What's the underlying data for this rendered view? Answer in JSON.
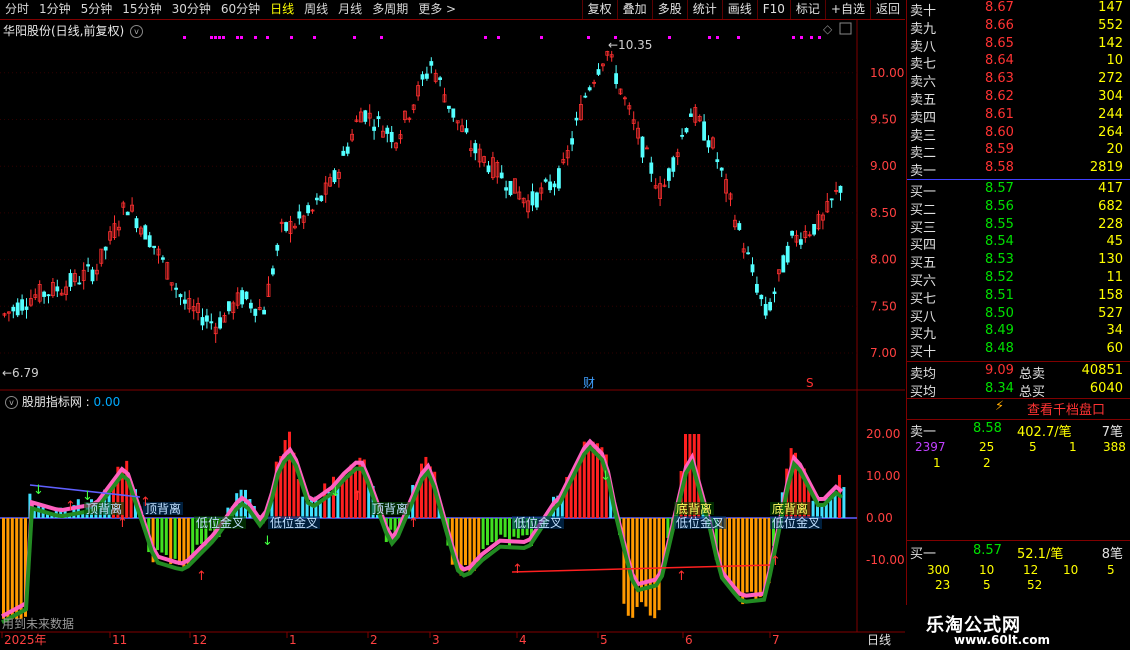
{
  "periods": [
    "分时",
    "1分钟",
    "5分钟",
    "15分钟",
    "30分钟",
    "60分钟",
    "日线",
    "周线",
    "月线",
    "多周期",
    "更多 >"
  ],
  "active_period": "日线",
  "tools": [
    "复权",
    "叠加",
    "多股",
    "统计",
    "画线",
    "F10",
    "标记",
    "+自选",
    "返回"
  ],
  "stock_title": "华阳股份(日线,前复权)",
  "price_axis": [
    "10.00",
    "9.50",
    "9.00",
    "8.50",
    "8.00",
    "7.50",
    "7.00"
  ],
  "high_label": "10.35",
  "low_label": "6.79",
  "marker_cai": "财",
  "marker_s": "S",
  "indicator_title": "股朋指标网",
  "indicator_value": "0.00",
  "ind_axis": [
    "20.00",
    "10.00",
    "0.00",
    "-10.00"
  ],
  "ind_labels": [
    "顶背离",
    "顶背离",
    "低位金叉",
    "低位金叉",
    "顶背离",
    "低位金叉",
    "底背离",
    "低位金叉",
    "底背离",
    "低位金叉"
  ],
  "future_note": "用到未来数据",
  "date_axis": [
    "2025年",
    "11",
    "12",
    "1",
    "2",
    "3",
    "4",
    "5",
    "6",
    "7"
  ],
  "period_footer": "日线",
  "orderbook": {
    "asks": [
      [
        "卖十",
        "8.67",
        "147"
      ],
      [
        "卖九",
        "8.66",
        "552"
      ],
      [
        "卖八",
        "8.65",
        "142"
      ],
      [
        "卖七",
        "8.64",
        "10"
      ],
      [
        "卖六",
        "8.63",
        "272"
      ],
      [
        "卖五",
        "8.62",
        "304"
      ],
      [
        "卖四",
        "8.61",
        "244"
      ],
      [
        "卖三",
        "8.60",
        "264"
      ],
      [
        "卖二",
        "8.59",
        "20"
      ],
      [
        "卖一",
        "8.58",
        "2819"
      ]
    ],
    "bids": [
      [
        "买一",
        "8.57",
        "417"
      ],
      [
        "买二",
        "8.56",
        "682"
      ],
      [
        "买三",
        "8.55",
        "228"
      ],
      [
        "买四",
        "8.54",
        "45"
      ],
      [
        "买五",
        "8.53",
        "130"
      ],
      [
        "买六",
        "8.52",
        "11"
      ],
      [
        "买七",
        "8.51",
        "158"
      ],
      [
        "买八",
        "8.50",
        "527"
      ],
      [
        "买九",
        "8.49",
        "34"
      ],
      [
        "买十",
        "8.48",
        "60"
      ]
    ],
    "avg_sell_label": "卖均",
    "avg_sell": "9.09",
    "total_sell_label": "总卖",
    "total_sell": "40851",
    "avg_buy_label": "买均",
    "avg_buy": "8.34",
    "total_buy_label": "总买",
    "total_buy": "6040",
    "view_1000": "查看千档盘口",
    "sell1_label": "卖一",
    "sell1_price": "8.58",
    "sell1_vol": "402.7/笔",
    "sell1_count": "7笔",
    "sell1_orders": [
      "2397",
      "25",
      "5",
      "1",
      "388",
      "1",
      "2"
    ],
    "buy1_label": "买一",
    "buy1_price": "8.57",
    "buy1_vol": "52.1/笔",
    "buy1_count": "8笔",
    "buy1_orders": [
      "300",
      "10",
      "12",
      "10",
      "5",
      "23",
      "5",
      "52"
    ]
  },
  "logo_text": "乐淘公式网",
  "logo_url": "www.60lt.com"
}
